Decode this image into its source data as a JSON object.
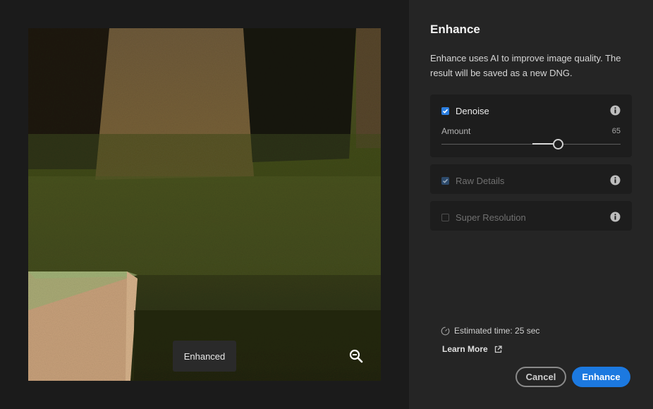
{
  "preview": {
    "label": "Enhanced",
    "zoom_icon": "zoom-out-icon"
  },
  "panel": {
    "title": "Enhance",
    "description": "Enhance uses AI to improve image quality. The result will be saved as a new DNG."
  },
  "options": {
    "denoise": {
      "label": "Denoise",
      "checked": true,
      "info_icon": "info-icon",
      "amount_label": "Amount",
      "amount_value": "65",
      "amount": 65,
      "max": 100
    },
    "raw_details": {
      "label": "Raw Details",
      "checked": true,
      "disabled": true,
      "info_icon": "info-icon"
    },
    "super_resolution": {
      "label": "Super Resolution",
      "checked": false,
      "disabled": true,
      "info_icon": "info-icon"
    }
  },
  "footer": {
    "estimated_time": "Estimated time: 25 sec",
    "learn_more": "Learn More",
    "cancel_label": "Cancel",
    "enhance_label": "Enhance"
  },
  "colors": {
    "accent": "#1c79e0",
    "panel_bg": "#252525",
    "card_bg": "#1d1d1d"
  }
}
